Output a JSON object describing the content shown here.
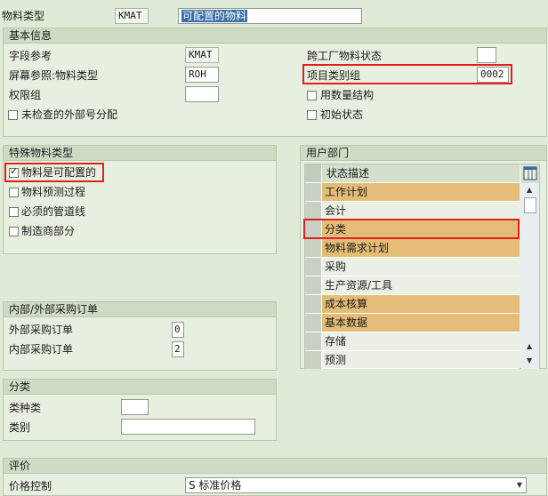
{
  "header": {
    "material_type_label": "物料类型",
    "material_type_code": "KMAT",
    "material_type_desc": "可配置的物料"
  },
  "basic_info": {
    "title": "基本信息",
    "field_ref_label": "字段参考",
    "field_ref_value": "KMAT",
    "screen_ref_label": "屏幕参照:物料类型",
    "screen_ref_value": "ROH",
    "auth_group_label": "权限组",
    "auth_group_value": "",
    "unchecked_ext_label": "未检查的外部号分配",
    "cross_plant_label": "跨工厂物料状态",
    "cross_plant_value": "",
    "item_cat_group_label": "项目类别组",
    "item_cat_group_value": "0002",
    "qty_structure_label": "用数量结构",
    "initial_status_label": "初始状态"
  },
  "special_material": {
    "title": "特殊物料类型",
    "items": [
      {
        "label": "物料是可配置的",
        "checked": true
      },
      {
        "label": "物料预测过程",
        "checked": false
      },
      {
        "label": "必须的管道线",
        "checked": false
      },
      {
        "label": "制造商部分",
        "checked": false
      }
    ]
  },
  "user_dept": {
    "title": "用户部门",
    "column_header": "状态描述",
    "rows": [
      {
        "label": "工作计划",
        "highlighted": true
      },
      {
        "label": "会计",
        "highlighted": false
      },
      {
        "label": "分类",
        "highlighted": true
      },
      {
        "label": "物料需求计划",
        "highlighted": true
      },
      {
        "label": "采购",
        "highlighted": false
      },
      {
        "label": "生产资源/工具",
        "highlighted": false
      },
      {
        "label": "成本核算",
        "highlighted": true
      },
      {
        "label": "基本数据",
        "highlighted": true
      },
      {
        "label": "存储",
        "highlighted": false
      },
      {
        "label": "预测",
        "highlighted": false
      }
    ]
  },
  "purchase_order": {
    "title": "内部/外部采购订单",
    "external_label": "外部采购订单",
    "external_value": "0",
    "internal_label": "内部采购订单",
    "internal_value": "2"
  },
  "classification": {
    "title": "分类",
    "class_type_label": "类种类",
    "class_type_value": "",
    "class_label": "类别",
    "class_value": ""
  },
  "valuation": {
    "title": "评价",
    "price_control_label": "价格控制",
    "price_control_value": "S 标准价格"
  },
  "colors": {
    "highlight_row": "#e4bc77",
    "red_outline": "#e01f1f",
    "background": "#dfebd6"
  }
}
